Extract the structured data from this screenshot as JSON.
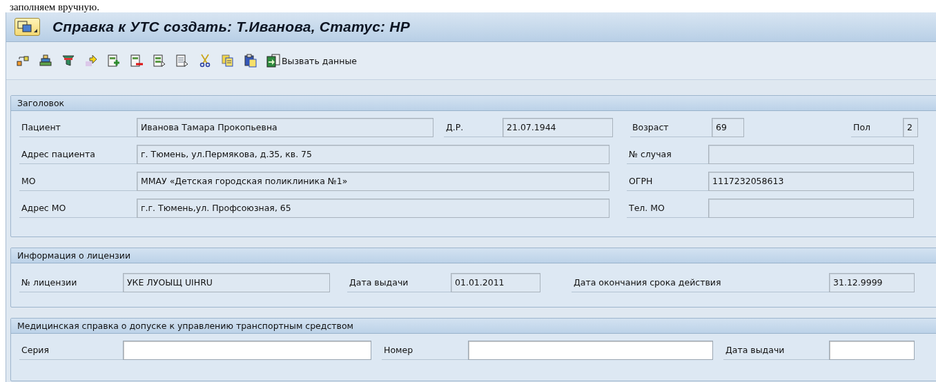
{
  "document_caption": "заполняем вручную.",
  "window": {
    "title": "Справка к УТС создать: Т.Иванова, Статус: НР"
  },
  "toolbar": [
    {
      "kind": "hierarchy"
    },
    {
      "kind": "stack"
    },
    {
      "kind": "filter"
    },
    {
      "kind": "forward"
    },
    {
      "kind": "add-row"
    },
    {
      "kind": "delete-row"
    },
    {
      "kind": "select-rows"
    },
    {
      "kind": "details"
    },
    {
      "kind": "cut"
    },
    {
      "kind": "copy"
    },
    {
      "kind": "paste"
    },
    {
      "kind": "fetch",
      "label": "Вызвать данные"
    }
  ],
  "groups": [
    {
      "title": "Заголовок",
      "rows": [
        [
          {
            "label": "Пациент",
            "value": "Иванова Тамара Прокопьевна",
            "disabled": true
          },
          {
            "label": "Д.Р.",
            "value": "21.07.1944",
            "disabled": true
          },
          {
            "label": "Возраст",
            "value": "69",
            "disabled": true
          },
          {
            "label": "Пол",
            "value": "2",
            "disabled": true
          }
        ],
        [
          {
            "label": "Адрес пациента",
            "value": "г. Тюмень, ул.Пермякова, д.35, кв. 75",
            "disabled": true
          },
          {
            "label": "№ случая",
            "disabled": true
          }
        ],
        [
          {
            "label": "МО",
            "value": "ММАУ «Детская городская поликлиника №1»",
            "disabled": true
          },
          {
            "label": "ОГРН",
            "value": "1117232058613",
            "disabled": true
          }
        ],
        [
          {
            "label": "Адрес МО",
            "value": "г.г. Тюмень,ул. Профсоюзная, 65",
            "disabled": true
          },
          {
            "label": "Тел. МО",
            "disabled": true
          }
        ]
      ]
    },
    {
      "title": "Информация о лицензии",
      "rows": [
        [
          {
            "label": "№ лицензии",
            "value": "УКЕ ЛУОЫЩ UIHRU",
            "disabled": true
          },
          {
            "label": "Дата выдачи",
            "value": "01.01.2011",
            "disabled": true
          },
          {
            "label": "Дата окончания срока действия",
            "value": "31.12.9999",
            "disabled": true
          }
        ]
      ]
    },
    {
      "title": "Медицинская справка о допуске к управлению транспортным средством",
      "rows": [
        [
          {
            "label": "Серия",
            "disabled": false
          },
          {
            "label": "Номер",
            "disabled": false
          },
          {
            "label": "Дата выдачи",
            "disabled": false
          }
        ]
      ]
    }
  ]
}
